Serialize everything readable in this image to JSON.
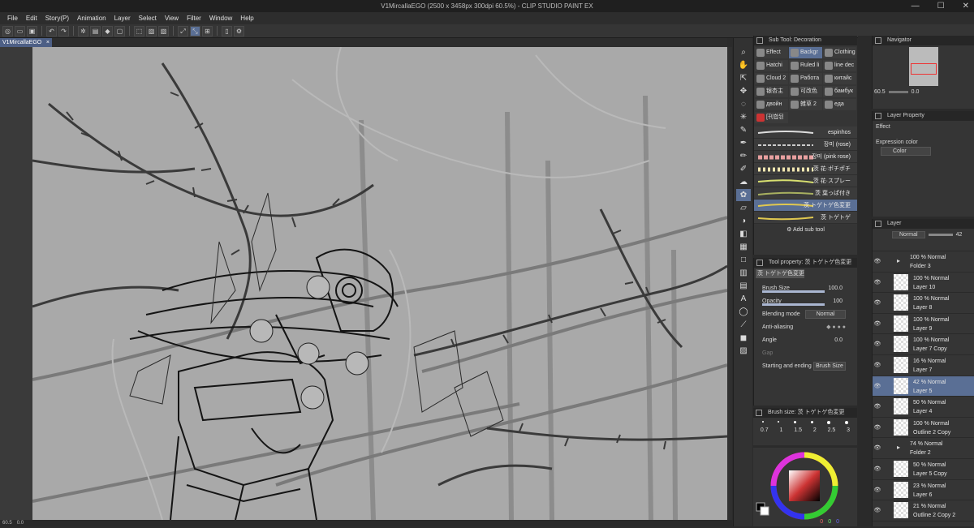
{
  "window": {
    "title": "V1MircallaEGO (2500 x 3458px 300dpi 60.5%)  - CLIP STUDIO PAINT EX",
    "minimize": "—",
    "maximize": "☐",
    "close": "✕"
  },
  "menu": [
    "File",
    "Edit",
    "Story(P)",
    "Animation",
    "Layer",
    "Select",
    "View",
    "Filter",
    "Window",
    "Help"
  ],
  "document_tab": {
    "label": "V1MircallaEGO",
    "close": "×"
  },
  "status": {
    "zoom": "60.5",
    "angle": "0.0"
  },
  "subtool": {
    "header": "Sub Tool: Decoration",
    "tags": [
      [
        "Effect",
        "Backgr",
        "Clothing"
      ],
      [
        "Hatchi",
        "Ruled li",
        "line dec"
      ],
      [
        "Cloud 2",
        "Работа",
        "китайс"
      ],
      [
        "银杏主",
        "可改色",
        "бамбук"
      ],
      [
        "двойн",
        "雑草 2",
        "еда"
      ],
      [
        "[刊합된"
      ]
    ],
    "brushes": [
      "espinhos",
      "장미 (rose)",
      "장미 (pink rose)",
      "茨 花·ポチポチ",
      "茨 花·スプレー",
      "茨 葉っぱ付き",
      "茨 トゲトゲ色変更",
      "茨 トゲトゲ"
    ],
    "add_label": "Add sub tool"
  },
  "tool_property": {
    "header": "Tool property: 茨 トゲトゲ色変更",
    "name": "茨 トゲトゲ色変更",
    "brush_size_label": "Brush Size",
    "brush_size_value": "100.0",
    "opacity_label": "Opacity",
    "opacity_value": "100",
    "blending_label": "Blending mode",
    "blending_value": "Normal",
    "antialias_label": "Anti-aliasing",
    "angle_label": "Angle",
    "angle_value": "0.0",
    "gap_label": "Gap",
    "start_end_label": "Starting and ending",
    "start_end_value": "Brush Size"
  },
  "brush_size_panel": {
    "header": "Brush size: 茨 トゲトゲ色変更",
    "sizes": [
      "0.7",
      "1",
      "1.5",
      "2",
      "2.5",
      "3"
    ]
  },
  "color": {
    "r": "0",
    "g": "0",
    "b": "0"
  },
  "navigator": {
    "header": "Navigator",
    "zoom": "60.5",
    "angle": "0.0"
  },
  "layer_property": {
    "header": "Layer Property",
    "effect_label": "Effect",
    "expression_label": "Expression color",
    "expression_value": "Color"
  },
  "layer_panel": {
    "header": "Layer",
    "blend": "Normal",
    "opacity": "42",
    "layers": [
      {
        "line1": "100 % Normal",
        "line2": "Folder 3",
        "folder": true,
        "selected": false,
        "indent": 0
      },
      {
        "line1": "100 % Normal",
        "line2": "Layer 10",
        "folder": false,
        "selected": false,
        "indent": 1
      },
      {
        "line1": "100 % Normal",
        "line2": "Layer 8",
        "folder": false,
        "selected": false,
        "indent": 1
      },
      {
        "line1": "100 % Normal",
        "line2": "Layer 9",
        "folder": false,
        "selected": false,
        "indent": 1
      },
      {
        "line1": "100 % Normal",
        "line2": "Layer 7 Copy",
        "folder": false,
        "selected": false,
        "indent": 1
      },
      {
        "line1": "16 % Normal",
        "line2": "Layer 7",
        "folder": false,
        "selected": false,
        "indent": 1
      },
      {
        "line1": "42 % Normal",
        "line2": "Layer 5",
        "folder": false,
        "selected": true,
        "indent": 1
      },
      {
        "line1": "50 % Normal",
        "line2": "Layer 4",
        "folder": false,
        "selected": false,
        "indent": 1
      },
      {
        "line1": "100 % Normal",
        "line2": "Outline 2 Copy",
        "folder": false,
        "selected": false,
        "indent": 1
      },
      {
        "line1": "74 % Normal",
        "line2": "Folder 2",
        "folder": true,
        "selected": false,
        "indent": 0
      },
      {
        "line1": "50 % Normal",
        "line2": "Layer 5 Copy",
        "folder": false,
        "selected": false,
        "indent": 1
      },
      {
        "line1": "23 % Normal",
        "line2": "Layer 6",
        "folder": false,
        "selected": false,
        "indent": 1
      },
      {
        "line1": "21 % Normal",
        "line2": "Outline 2 Copy 2",
        "folder": false,
        "selected": false,
        "indent": 1
      }
    ]
  },
  "colors": {
    "accent": "#5a6f95",
    "canvas": "#a9a9a9",
    "panel": "#353535"
  }
}
